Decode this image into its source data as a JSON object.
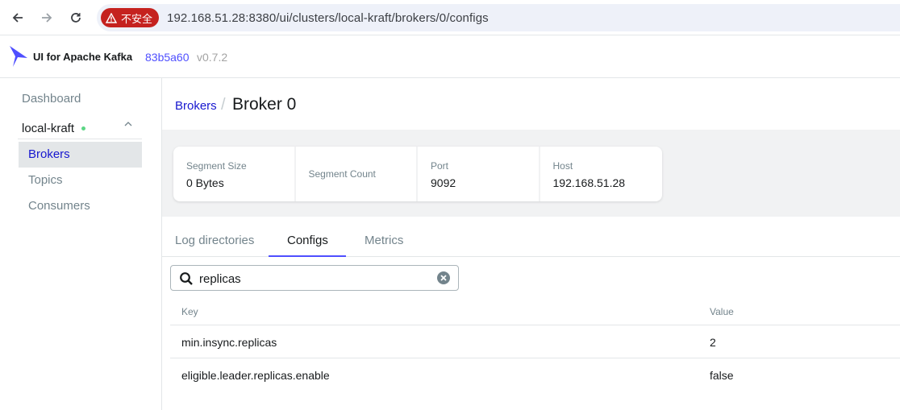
{
  "browser": {
    "security_label": "不安全",
    "url": "192.168.51.28:8380/ui/clusters/local-kraft/brokers/0/configs"
  },
  "header": {
    "app_title": "UI for Apache Kafka",
    "version_hash": "83b5a60",
    "version": "v0.7.2"
  },
  "sidebar": {
    "dashboard": "Dashboard",
    "cluster": "local-kraft",
    "items": [
      {
        "label": "Brokers",
        "active": true
      },
      {
        "label": "Topics",
        "active": false
      },
      {
        "label": "Consumers",
        "active": false
      }
    ]
  },
  "breadcrumb": {
    "parent": "Brokers",
    "separator": "/",
    "current": "Broker 0"
  },
  "stats": [
    {
      "label": "Segment Size",
      "value": "0 Bytes"
    },
    {
      "label": "Segment Count",
      "value": ""
    },
    {
      "label": "Port",
      "value": "9092"
    },
    {
      "label": "Host",
      "value": "192.168.51.28"
    }
  ],
  "tabs": [
    {
      "label": "Log directories",
      "active": false
    },
    {
      "label": "Configs",
      "active": true
    },
    {
      "label": "Metrics",
      "active": false
    }
  ],
  "search": {
    "value": "replicas"
  },
  "table": {
    "headers": {
      "key": "Key",
      "value": "Value"
    },
    "rows": [
      {
        "key": "min.insync.replicas",
        "value": "2"
      },
      {
        "key": "eligible.leader.replicas.enable",
        "value": "false"
      }
    ]
  },
  "colors": {
    "accent": "#4f4fff",
    "link": "#1717cf",
    "status_online": "#5cd685",
    "insecure": "#c5221f"
  }
}
